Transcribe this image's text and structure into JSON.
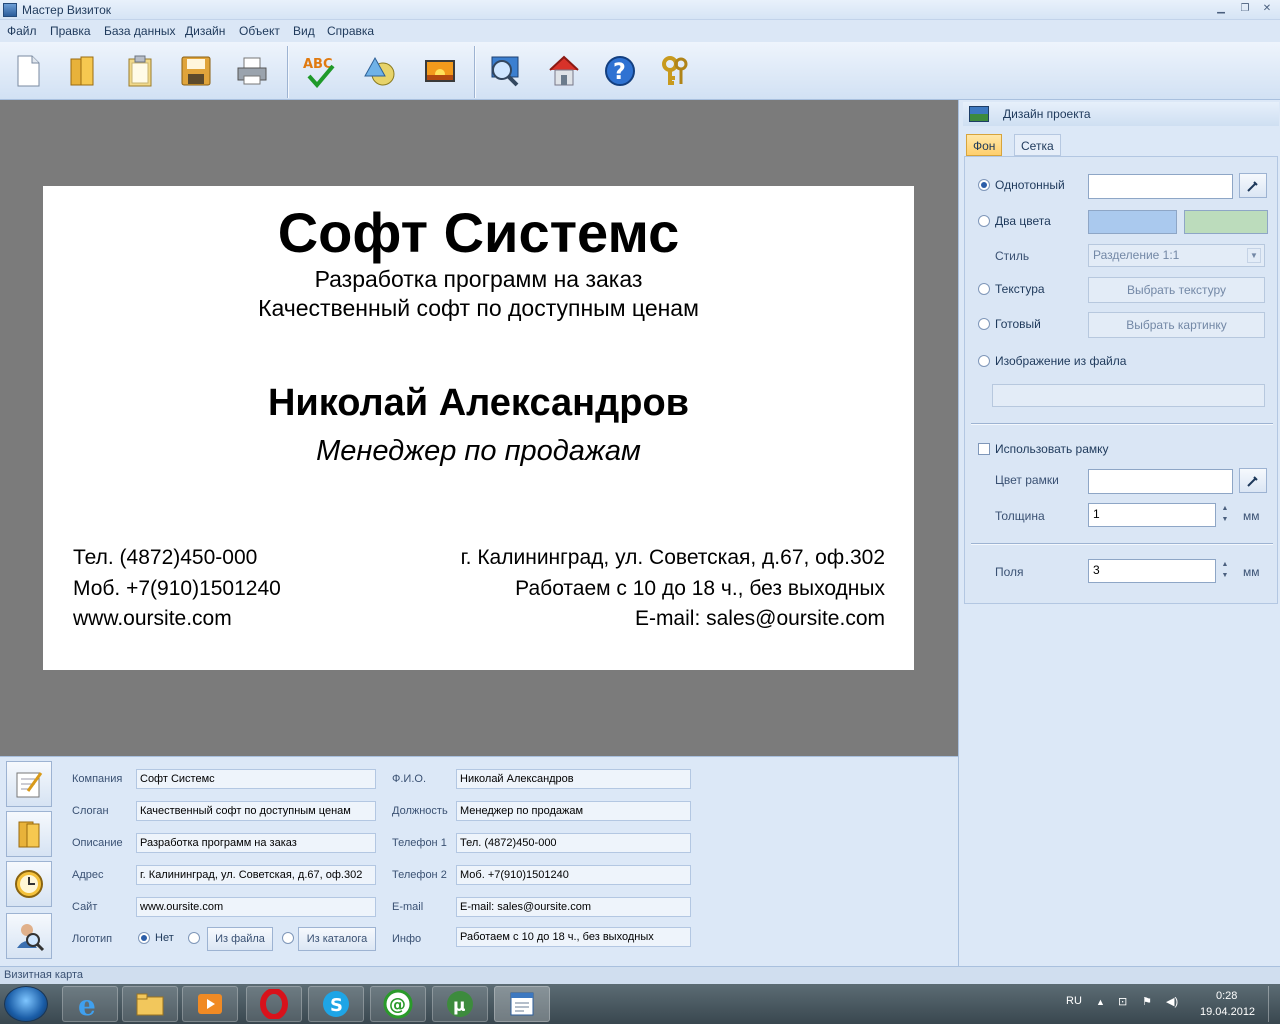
{
  "window": {
    "title": "Мастер Визиток"
  },
  "menu": [
    "Файл",
    "Правка",
    "База данных",
    "Дизайн",
    "Объект",
    "Вид",
    "Справка"
  ],
  "toolbar": [
    {
      "icon": "new-document-icon"
    },
    {
      "icon": "open-folder-icon"
    },
    {
      "icon": "clipboard-icon"
    },
    {
      "icon": "save-icon"
    },
    {
      "icon": "print-icon"
    },
    {
      "icon": "spellcheck-icon",
      "text": "ABC"
    },
    {
      "icon": "shapes-icon"
    },
    {
      "icon": "image-icon"
    },
    {
      "icon": "zoom-icon"
    },
    {
      "icon": "home-icon"
    },
    {
      "icon": "help-icon",
      "text": "?"
    },
    {
      "icon": "keys-icon"
    }
  ],
  "card": {
    "company": "Софт Системс",
    "description": "Разработка программ на заказ",
    "slogan": "Качественный софт по доступным ценам",
    "name": "Николай Александров",
    "position": "Менеджер по продажам",
    "phone1": "Тел. (4872)450-000",
    "phone2": "Моб. +7(910)1501240",
    "site": "www.oursite.com",
    "address": "г. Калининград, ул. Советская, д.67, оф.302",
    "info": "Работаем с 10 до 18 ч., без выходных",
    "email": "E-mail: sales@oursite.com"
  },
  "design_panel": {
    "title": "Дизайн проекта",
    "tabs": [
      "Фон",
      "Сетка"
    ],
    "active_tab": "Фон",
    "solid_label": "Однотонный",
    "two_colors_label": "Два цвета",
    "style_label": "Стиль",
    "style_value": "Разделение 1:1",
    "texture_label": "Текстура",
    "texture_button": "Выбрать текстуру",
    "ready_label": "Готовый",
    "picture_button": "Выбрать картинку",
    "file_image_label": "Изображение из файла",
    "use_frame_label": "Использовать рамку",
    "frame_color_label": "Цвет рамки",
    "thickness_label": "Толщина",
    "thickness_value": "1",
    "margins_label": "Поля",
    "margins_value": "3",
    "unit": "мм",
    "colors": {
      "solid": "#ffffff",
      "two_a": "#aac9ee",
      "two_b": "#bcdcbc",
      "frame": "#ffffff"
    }
  },
  "form": {
    "company_label": "Компания",
    "company": "Софт Системс",
    "slogan_label": "Слоган",
    "slogan": "Качественный софт по доступным ценам",
    "description_label": "Описание",
    "description": "Разработка программ на заказ",
    "address_label": "Адрес",
    "address": "г. Калининград, ул. Советская, д.67, оф.302",
    "site_label": "Сайт",
    "site": "www.oursite.com",
    "logo_label": "Логотип",
    "logo_none": "Нет",
    "logo_file": "Из файла",
    "logo_catalog": "Из каталога",
    "fio_label": "Ф.И.О.",
    "fio": "Николай Александров",
    "position_label": "Должность",
    "position": "Менеджер по продажам",
    "phone1_label": "Телефон 1",
    "phone1": "Тел. (4872)450-000",
    "phone2_label": "Телефон 2",
    "phone2": "Моб. +7(910)1501240",
    "email_label": "E-mail",
    "email": "E-mail: sales@oursite.com",
    "info_label": "Инфо",
    "info": "Работаем с 10 до 18 ч., без выходных"
  },
  "status": "Визитная карта",
  "taskbar": {
    "lang": "RU",
    "time": "0:28",
    "date": "19.04.2012"
  }
}
